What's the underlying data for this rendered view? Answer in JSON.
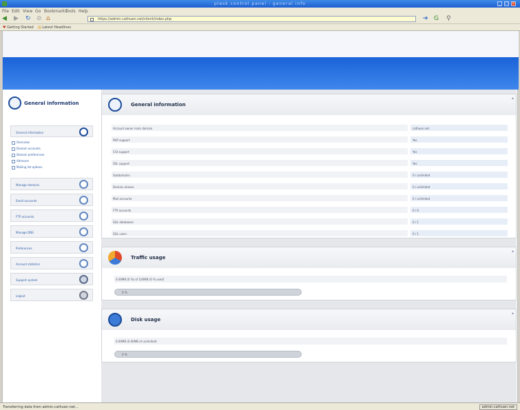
{
  "window": {
    "title": "plesk control panel - general info"
  },
  "menu": [
    "File",
    "Edit",
    "View",
    "Go",
    "Bookmarks",
    "Tools",
    "Help"
  ],
  "nav": {
    "url": "https://admin.cathuen.net/client/index.php"
  },
  "bookmarks": [
    "Getting Started",
    "Latest Headlines"
  ],
  "sidebar": {
    "title": "General information",
    "active_section": "General information",
    "sub_items": [
      "Overview",
      "Domain accounts",
      "Domain preferences",
      "Adresses",
      "Mailing list options"
    ],
    "sections": [
      "Manage domains",
      "Email accounts",
      "FTP accounts",
      "Manage DNS",
      "Preferences",
      "Account statistics",
      "Support system",
      "Logout"
    ]
  },
  "info_panel": {
    "title": "General information",
    "rows": [
      {
        "key": "Account owner main domain",
        "value": "cathuen.net"
      },
      {
        "key": "PHP support",
        "value": "Yes"
      },
      {
        "key": "CGI support",
        "value": "Yes"
      },
      {
        "key": "SSL support",
        "value": "Yes"
      },
      {
        "key": "Subdomains",
        "value": "0 / unlimited"
      },
      {
        "key": "Domain aliases",
        "value": "0 / unlimited"
      },
      {
        "key": "Mail accounts",
        "value": "0 / unlimited"
      },
      {
        "key": "FTP accounts",
        "value": "0 / 0"
      },
      {
        "key": "SQL databases",
        "value": "0 / 1"
      },
      {
        "key": "SQL users",
        "value": "0 / 1"
      }
    ]
  },
  "traffic_panel": {
    "title": "Traffic usage",
    "text": "0.00MB (0 %) of 100MB (0 % used)",
    "bar_label": "0 %",
    "percent": 0
  },
  "disk_panel": {
    "title": "Disk usage",
    "text": "0.00MB (0.00MB of unlimited)",
    "bar_label": "0 %",
    "percent": 0
  },
  "status": {
    "left": "Transferring data from admin.cathuen.net...",
    "right": "admin.cathuen.net"
  }
}
